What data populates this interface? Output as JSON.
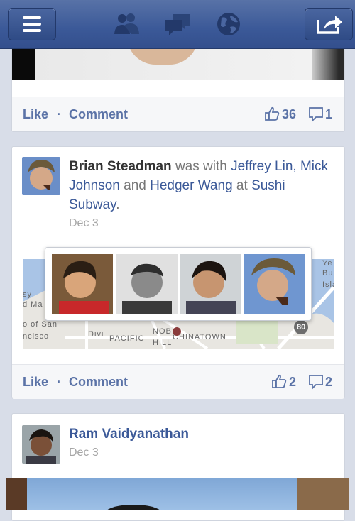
{
  "nav": {
    "icons": [
      "menu-icon",
      "friends-icon",
      "messages-icon",
      "globe-icon",
      "share-icon"
    ]
  },
  "posts": [
    {
      "actions": {
        "like": "Like",
        "separator": "·",
        "comment": "Comment",
        "like_count": "36",
        "comment_count": "1"
      }
    },
    {
      "author": "Brian Steadman",
      "text_with": "was with",
      "tagged1": "Jeffrey Lin,",
      "tagged2": "Mick Johnson",
      "and": "and",
      "tagged3": "Hedger Wang",
      "at": "at",
      "place": "Sushi Subway",
      "period": ".",
      "date": "Dec 3",
      "map_labels": [
        "sy",
        "d Ma",
        "o of San",
        "ncisco",
        "Divi",
        "PACIFIC",
        "NOB",
        "HILL",
        "CHINATOWN",
        "Ye",
        "Bu",
        "Isla",
        "80"
      ],
      "actions": {
        "like": "Like",
        "separator": "·",
        "comment": "Comment",
        "like_count": "2",
        "comment_count": "2"
      }
    },
    {
      "author": "Ram Vaidyanathan",
      "date": "Dec 3"
    }
  ],
  "colors": {
    "brand": "#3b5998",
    "link": "#3b5998",
    "action": "#5b73a7"
  }
}
